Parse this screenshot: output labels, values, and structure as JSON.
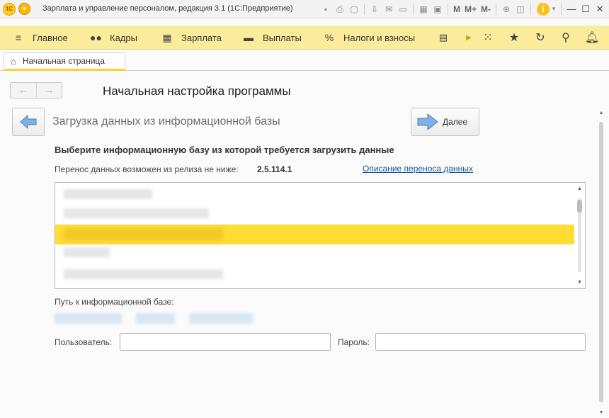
{
  "window": {
    "logo_text": "1С",
    "title": "Зарплата и управление персоналом, редакция 3.1  (1С:Предприятие)",
    "toolbar_text": [
      "M",
      "M+",
      "M-"
    ],
    "info_label": "i"
  },
  "sections": {
    "items": [
      {
        "icon": "menu-icon",
        "glyph": "≡",
        "label": "Главное"
      },
      {
        "icon": "people-icon",
        "glyph": "👥",
        "label": "Кадры"
      },
      {
        "icon": "calculator-icon",
        "glyph": "▦",
        "label": "Зарплата"
      },
      {
        "icon": "wallet-icon",
        "glyph": "▬",
        "label": "Выплаты"
      },
      {
        "icon": "percent-icon",
        "glyph": "%",
        "label": "Налоги и взносы"
      }
    ]
  },
  "tabs": {
    "home_label": "Начальная страница"
  },
  "form": {
    "title": "Начальная настройка программы",
    "step_title": "Загрузка данных из информационной базы",
    "next_label": "Далее",
    "choose_label": "Выберите информационную базу из которой требуется загрузить данные",
    "release_label": "Перенос данных возможен из релиза не ниже:",
    "release_value": "2.5.114.1",
    "link_label": "Описание переноса данных",
    "path_label": "Путь к информационной базе:",
    "user_label": "Пользователь:",
    "user_value": "",
    "password_label": "Пароль:",
    "password_value": ""
  },
  "colors": {
    "section_bar": "#fbec9b",
    "selection": "#ffdd33",
    "link": "#1a5296",
    "tab_accent": "#ffcf33"
  }
}
